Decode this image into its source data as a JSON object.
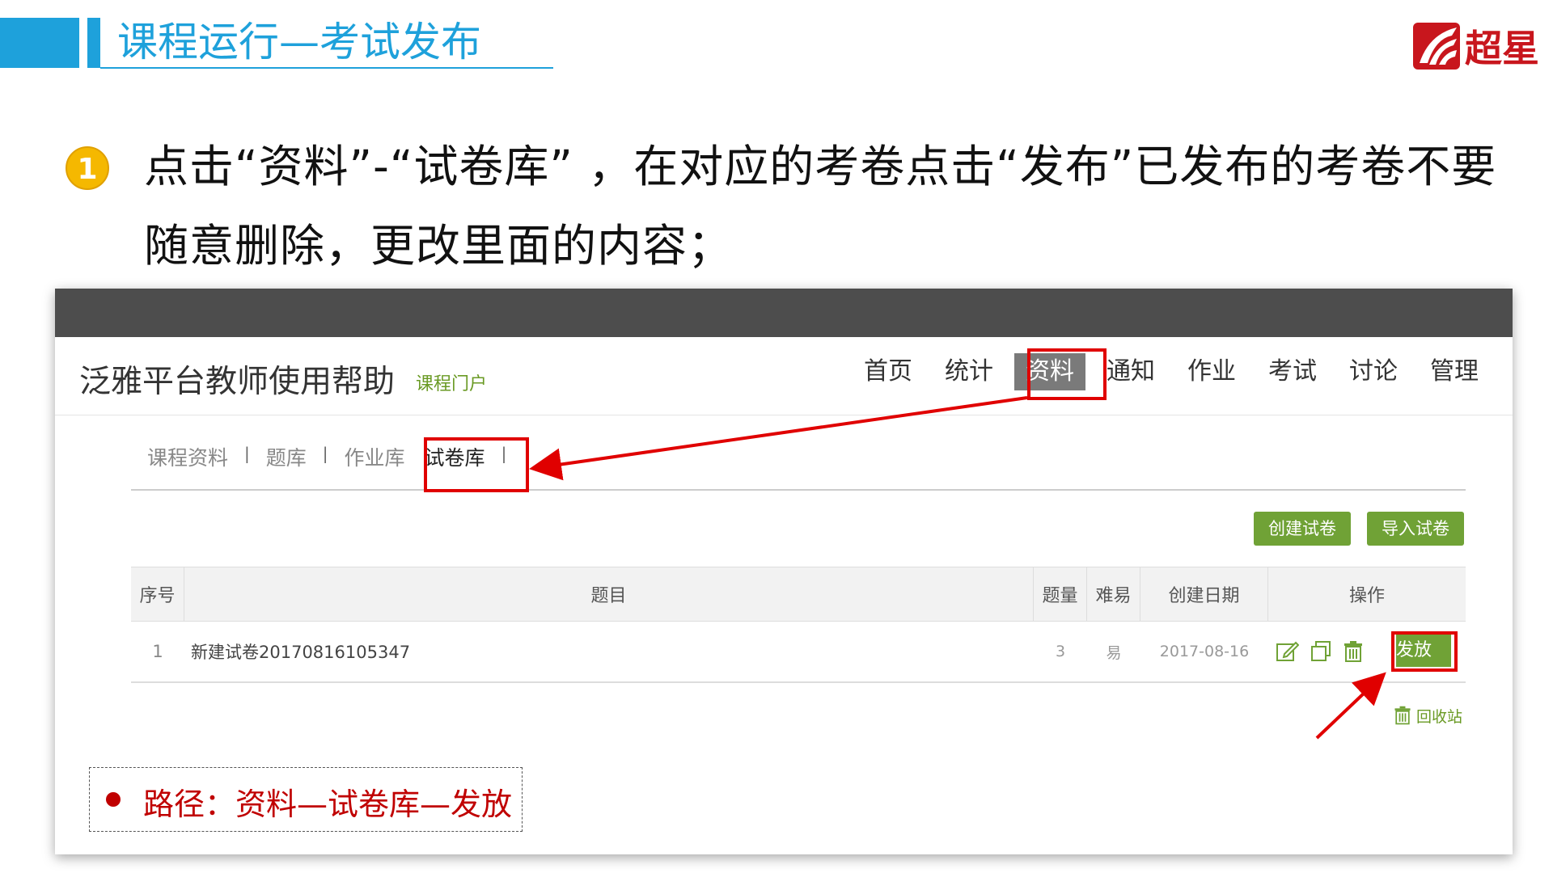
{
  "slide": {
    "title": "课程运行—考试发布",
    "logo_text": "超星",
    "bullet_number": "1",
    "bullet_text": "点击“资料”-“试卷库” ，在对应的考卷点击“发布”已发布的考卷不要随意删除，更改里面的内容；"
  },
  "colors": {
    "accent_blue": "#1ea1db",
    "highlight_red": "#e00000",
    "button_green": "#70a236",
    "badge_yellow": "#f5b800"
  },
  "screenshot": {
    "site_title": "泛雅平台教师使用帮助",
    "portal_link": "课程门户",
    "nav": [
      {
        "label": "首页"
      },
      {
        "label": "统计"
      },
      {
        "label": "资料",
        "active": true
      },
      {
        "label": "通知"
      },
      {
        "label": "作业"
      },
      {
        "label": "考试"
      },
      {
        "label": "讨论"
      },
      {
        "label": "管理"
      }
    ],
    "subnav": [
      "课程资料",
      "题库",
      "作业库",
      "试卷库"
    ],
    "subnav_current": "试卷库",
    "buttons": {
      "create": "创建试卷",
      "import": "导入试卷"
    },
    "table": {
      "headers": [
        "序号",
        "题目",
        "题量",
        "难易",
        "创建日期",
        "操作"
      ],
      "rows": [
        {
          "index": "1",
          "title": "新建试卷20170816105347",
          "count": "3",
          "difficulty": "易",
          "date": "2017-08-16",
          "action": "发放"
        }
      ]
    },
    "icons": [
      "edit-icon",
      "copy-icon",
      "delete-icon"
    ],
    "recycle_label": "回收站",
    "path_note": "路径：资料—试卷库—发放"
  }
}
